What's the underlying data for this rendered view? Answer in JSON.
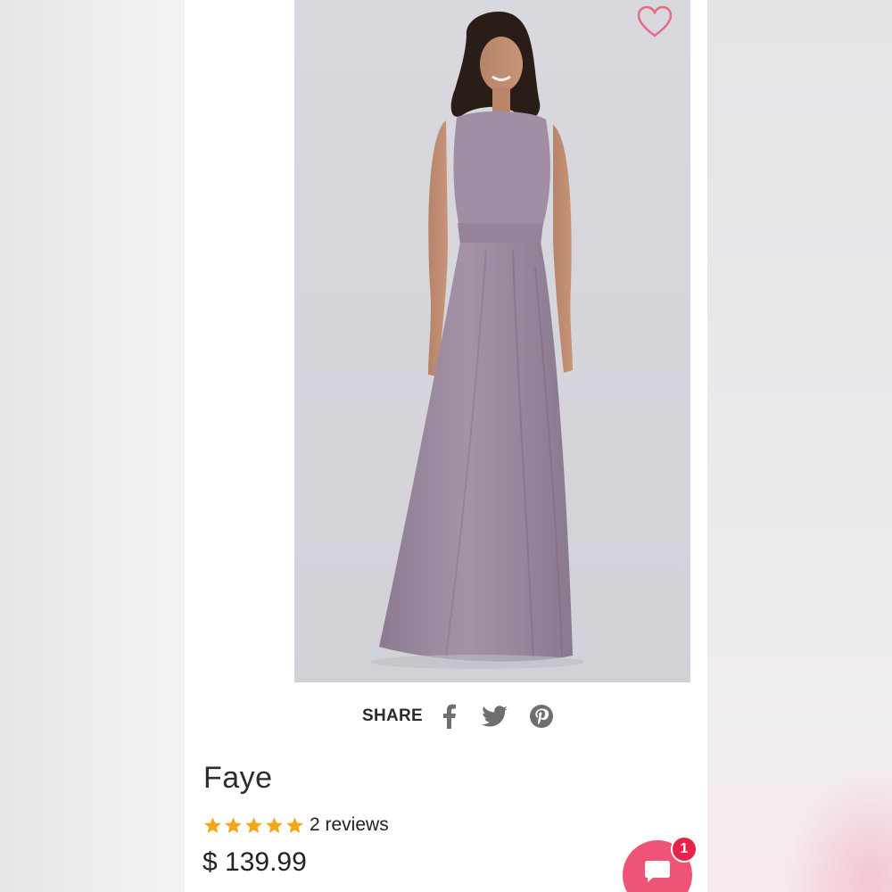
{
  "product": {
    "name": "Faye",
    "review_count_label": "2 reviews",
    "rating": 5,
    "rating_max": 5,
    "price": "$ 139.99",
    "color_swatch": "#9c8a9f"
  },
  "share": {
    "label": "SHARE",
    "networks": [
      "facebook-icon",
      "twitter-icon",
      "pinterest-icon"
    ]
  },
  "chat": {
    "unread_count": "1",
    "button_color": "#ef5478",
    "badge_color": "#e8234a"
  },
  "icons": {
    "wishlist": "heart-outline-icon",
    "star": "star-icon"
  },
  "colors": {
    "accent_pink": "#ef5478",
    "star_gold": "#f2a71b",
    "icon_gray": "#6e6e6e"
  }
}
